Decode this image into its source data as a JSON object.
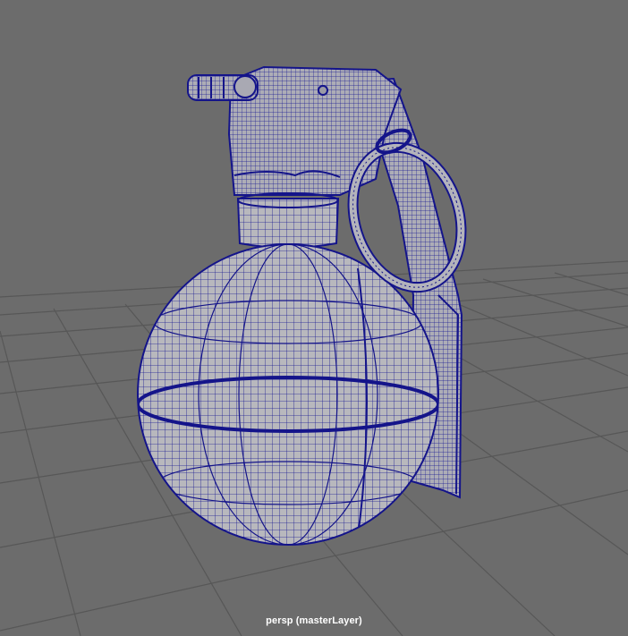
{
  "viewport": {
    "camera_label": "persp (masterLayer)",
    "colors": {
      "background": "#6c6c6c",
      "grid": "#5a5a5a",
      "mesh_fill": "#b9b9bd",
      "wireframe": "#0f0f8c",
      "label_text": "#ffffff"
    }
  },
  "scene": {
    "object": "grenade-model",
    "display_mode": "wireframe-on-shaded"
  }
}
